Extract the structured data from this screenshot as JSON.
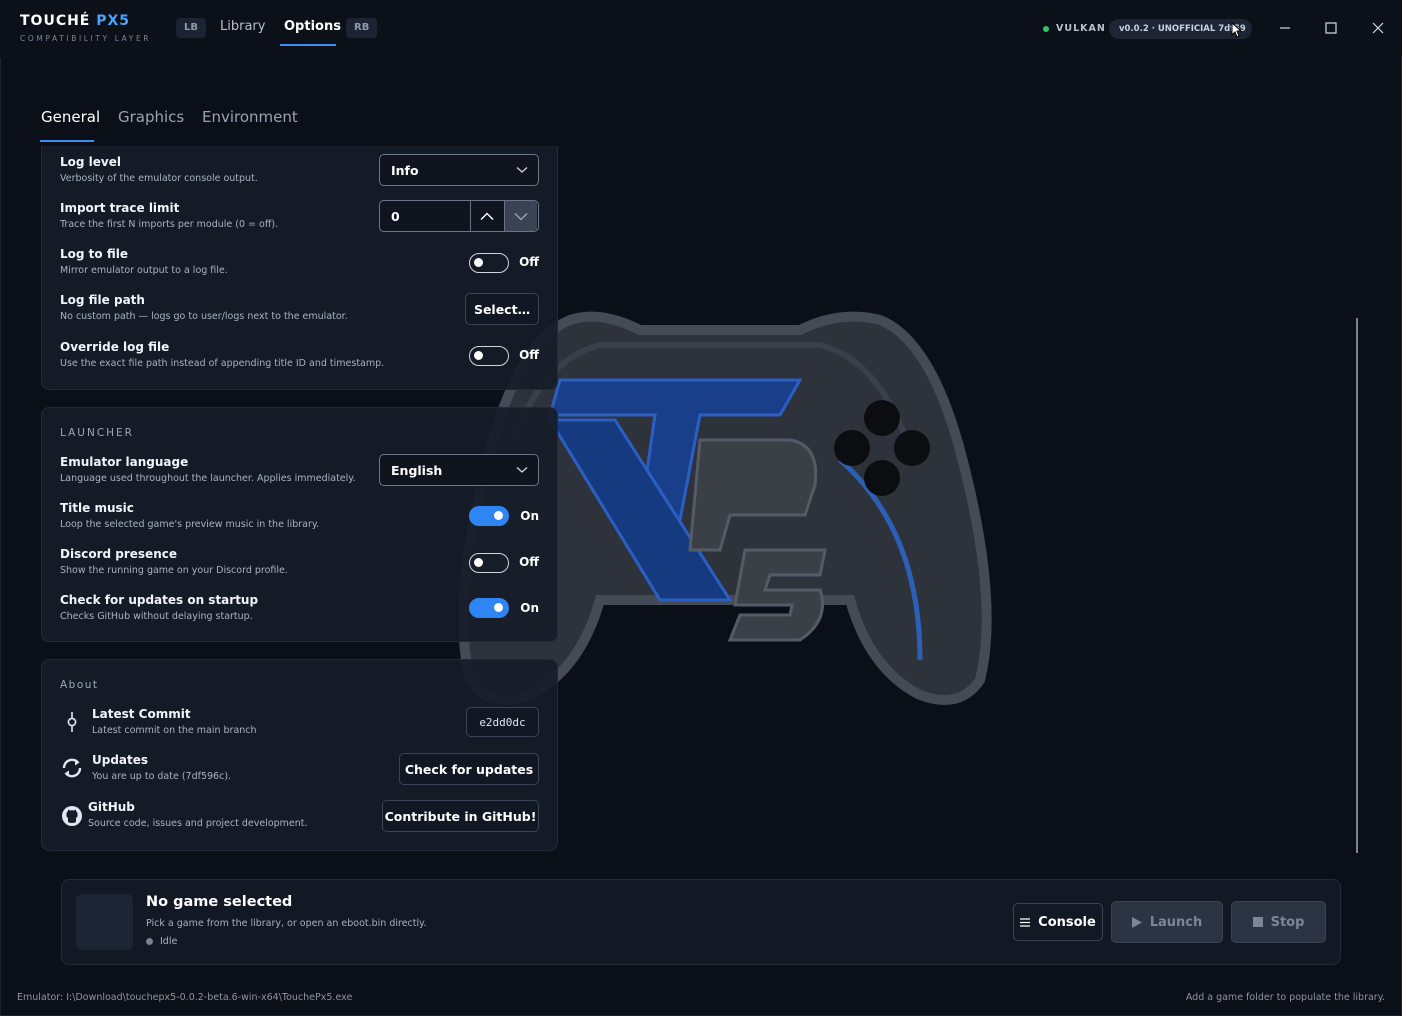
{
  "app": {
    "brand_name_prefix": "TOUCHÉ ",
    "brand_name_accent": "PX5",
    "brand_subtitle": "COMPATIBILITY LAYER",
    "accent_color": "#3d8ef0"
  },
  "nav": {
    "lb_label": "LB",
    "rb_label": "RB",
    "items": [
      {
        "label": "Library",
        "active": false
      },
      {
        "label": "Options",
        "active": true
      }
    ]
  },
  "status": {
    "renderer": "VULKAN",
    "version": "v0.0.2 · UNOFFICIAL 7df59",
    "status_color": "#35c46a"
  },
  "window_controls": [
    "minimize-icon",
    "maximize-icon",
    "close-icon"
  ],
  "tabs": [
    {
      "label": "General",
      "active": true
    },
    {
      "label": "Graphics",
      "active": false
    },
    {
      "label": "Environment",
      "active": false
    }
  ],
  "general": {
    "log_level": {
      "title": "Log level",
      "desc": "Verbosity of the emulator console output.",
      "value": "Info"
    },
    "import_trace": {
      "title": "Import trace limit",
      "desc": "Trace the first N imports per module (0 = off).",
      "value": "0"
    },
    "log_to_file": {
      "title": "Log to file",
      "desc": "Mirror emulator output to a log file.",
      "state": "Off"
    },
    "log_file_path": {
      "title": "Log file path",
      "desc": "No custom path — logs go to user/logs next to the emulator.",
      "button": "Select…"
    },
    "override_log": {
      "title": "Override log file",
      "desc": "Use the exact file path instead of appending title ID and timestamp.",
      "state": "Off"
    }
  },
  "launcher": {
    "section_title": "LAUNCHER",
    "language": {
      "title": "Emulator language",
      "desc": "Language used throughout the launcher. Applies immediately.",
      "value": "English"
    },
    "title_music": {
      "title": "Title music",
      "desc": "Loop the selected game's preview music in the library.",
      "state": "On"
    },
    "discord": {
      "title": "Discord presence",
      "desc": "Show the running game on your Discord profile.",
      "state": "Off"
    },
    "updates_startup": {
      "title": "Check for updates on startup",
      "desc": "Checks GitHub without delaying startup.",
      "state": "On"
    }
  },
  "about": {
    "section_title": "About",
    "commit": {
      "title": "Latest Commit",
      "desc": "Latest commit on the main branch",
      "value": "e2dd0dc",
      "icon": "commit-icon"
    },
    "updates": {
      "title": "Updates",
      "desc": "You are up to date (7df596c).",
      "button": "Check for updates",
      "icon": "refresh-icon"
    },
    "github": {
      "title": "GitHub",
      "desc": "Source code, issues and project development.",
      "button": "Contribute in GitHub!",
      "icon": "github-icon"
    }
  },
  "game_bar": {
    "title": "No game selected",
    "desc": "Pick a game from the library, or open an eboot.bin directly.",
    "status": "Idle",
    "console_label": "Console",
    "launch_label": "Launch",
    "stop_label": "Stop"
  },
  "footer": {
    "left": "Emulator: I:\\Download\\touchepx5-0.0.2-beta.6-win-x64\\TouchePx5.exe",
    "right": "Add a game folder to populate the library."
  }
}
